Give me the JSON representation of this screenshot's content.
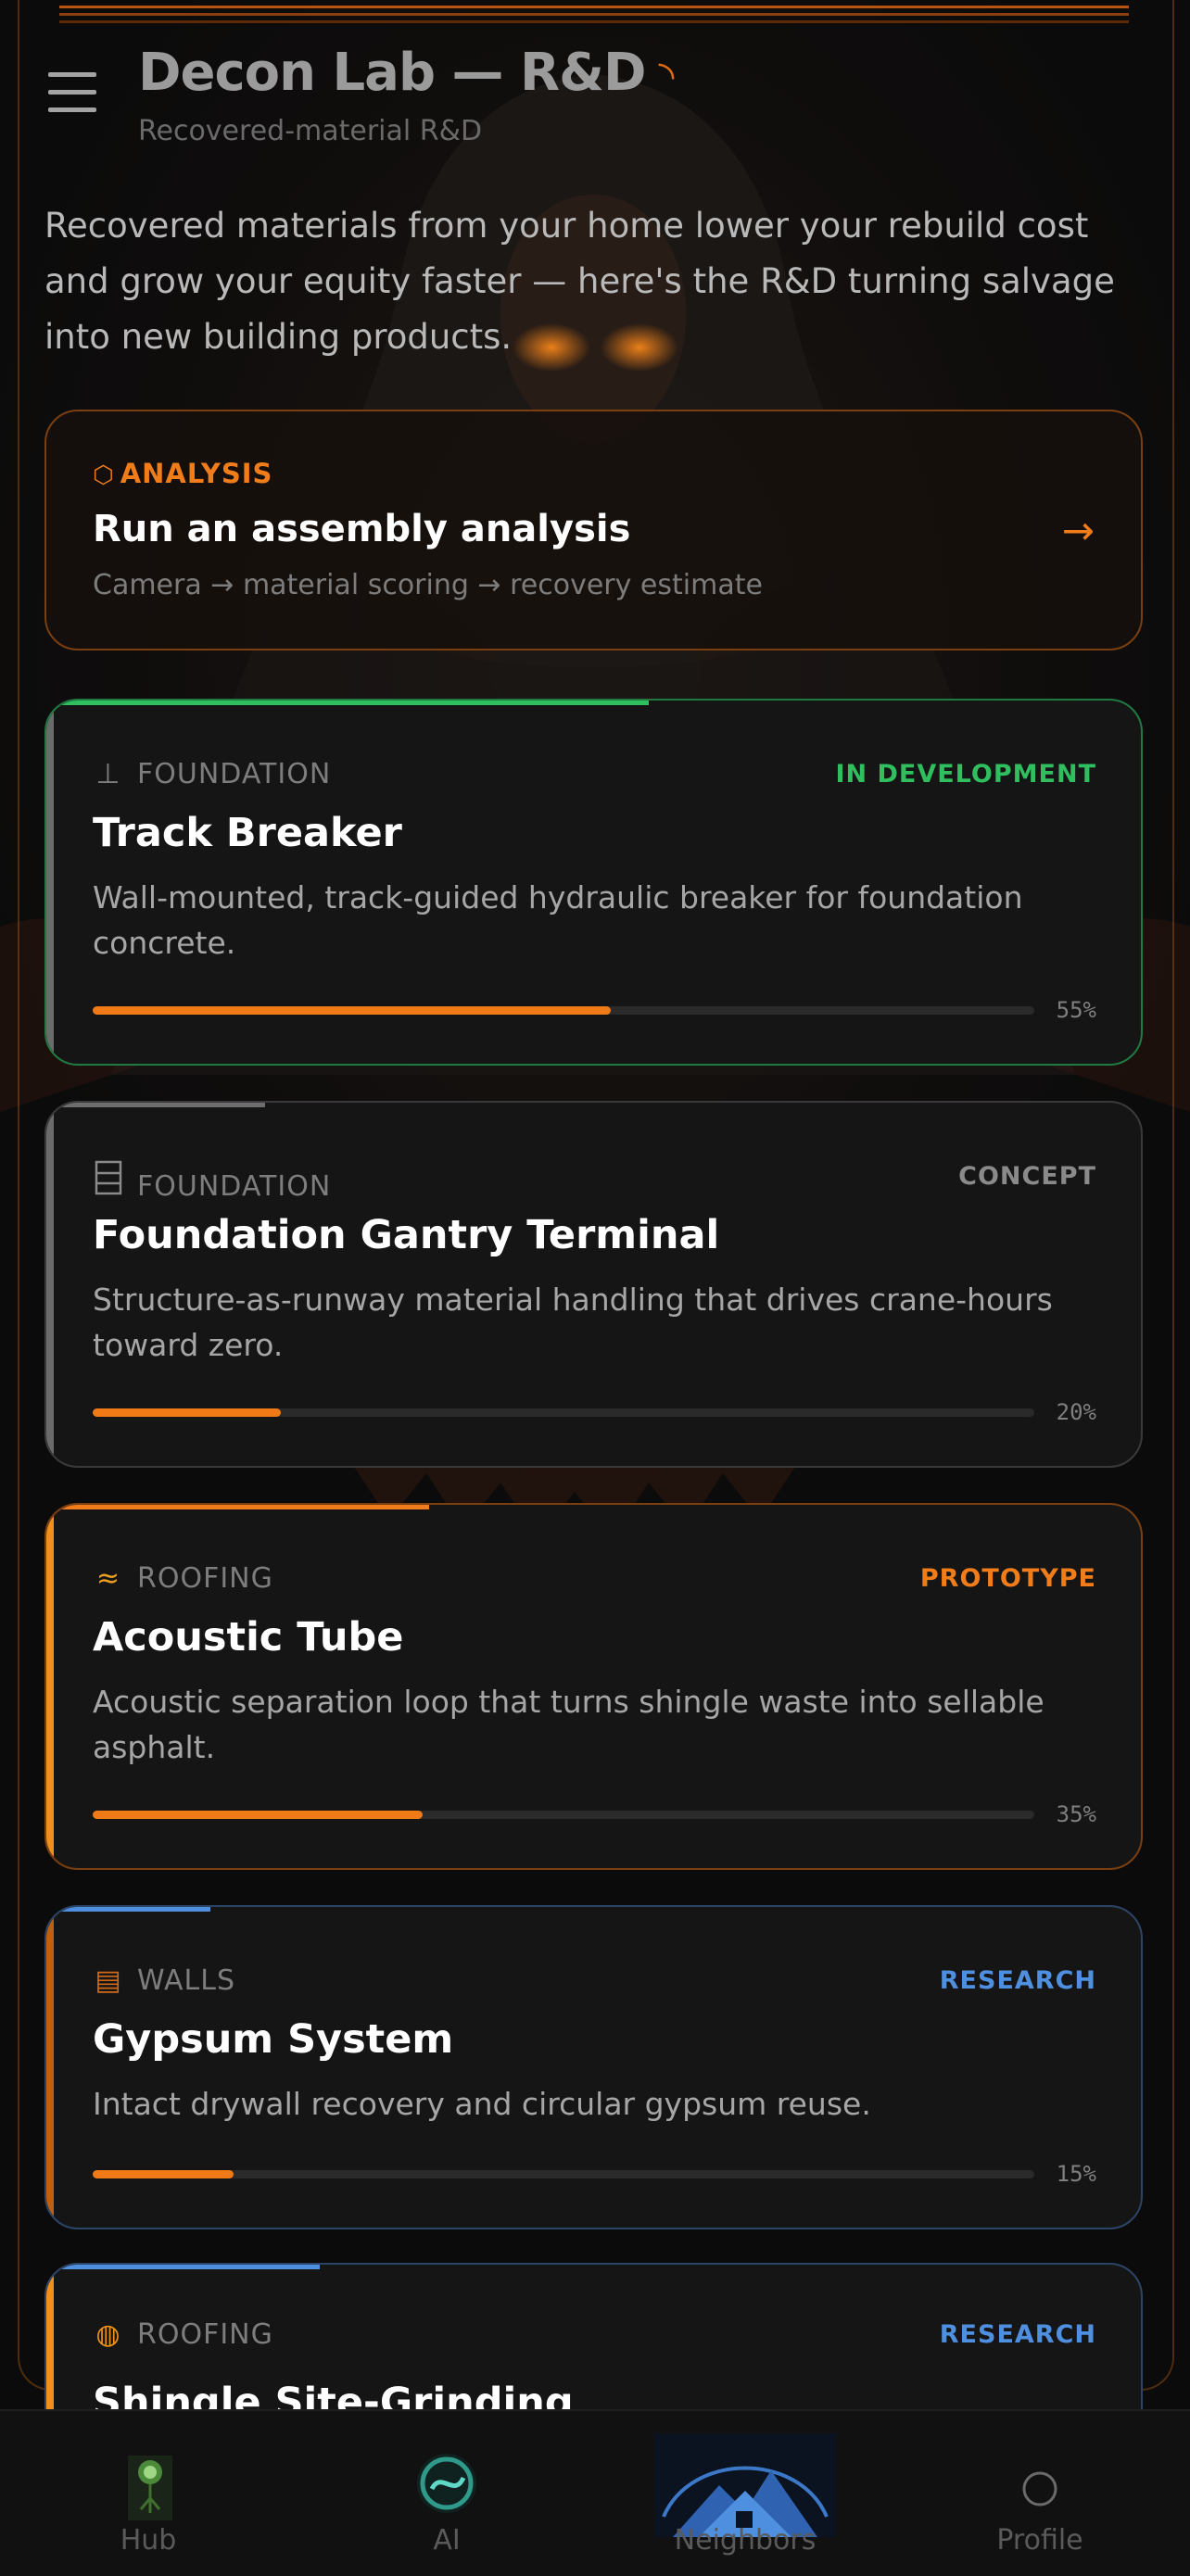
{
  "header": {
    "title": "Decon Lab — R&D",
    "title_glyph": "◝",
    "subtitle": "Recovered-material R&D"
  },
  "intro": "Recovered materials from your home lower your rebuild cost and grow your equity faster — here's the R&D turning salvage into new building products.",
  "analysis": {
    "eyebrow_icon": "⬡",
    "eyebrow": "ANALYSIS",
    "heading": "Run an assembly analysis",
    "sub": "Camera → material scoring → recovery estimate",
    "arrow": "→"
  },
  "projects": [
    {
      "icon": "foundation-icon",
      "icon_glyph": "⊥",
      "category": "FOUNDATION",
      "status": "IN DEVELOPMENT",
      "status_color": "#2fbf5f",
      "name": "Track Breaker",
      "description": "Wall-mounted, track-guided hydraulic breaker for foundation concrete.",
      "progress": 55,
      "progress_label": "55%"
    },
    {
      "icon": "building-icon",
      "icon_glyph": "",
      "category": "FOUNDATION",
      "status": "CONCEPT",
      "status_color": "#8a8a8a",
      "name": "Foundation Gantry Terminal",
      "description": "Structure-as-runway material handling that drives crane-hours toward zero.",
      "progress": 20,
      "progress_label": "20%"
    },
    {
      "icon": "waves-icon",
      "icon_glyph": "≈",
      "category": "ROOFING",
      "status": "PROTOTYPE",
      "status_color": "#f07d1a",
      "name": "Acoustic Tube",
      "description": "Acoustic separation loop that turns shingle waste into sellable asphalt.",
      "progress": 35,
      "progress_label": "35%"
    },
    {
      "icon": "drywall-icon",
      "icon_glyph": "▤",
      "category": "WALLS",
      "status": "RESEARCH",
      "status_color": "#4f8fe0",
      "name": "Gypsum System",
      "description": "Intact drywall recovery and circular gypsum reuse.",
      "progress": 15,
      "progress_label": "15%"
    },
    {
      "icon": "grinder-icon",
      "icon_glyph": "◍",
      "category": "ROOFING",
      "status": "RESEARCH",
      "status_color": "#4f8fe0",
      "name": "Shingle Site-Grinding",
      "description": "",
      "progress": null,
      "progress_label": ""
    }
  ],
  "tabs": [
    {
      "label": "Hub",
      "icon": "tree-orb-icon"
    },
    {
      "label": "AI",
      "icon": "ai-orb-icon"
    },
    {
      "label": "Neighbors",
      "icon": "houses-icon"
    },
    {
      "label": "Profile",
      "icon": "profile-circle-icon"
    }
  ],
  "colors": {
    "accent": "#f07d1a",
    "background": "#0c0b0b",
    "card": "#151516",
    "green": "#2fbf5f",
    "blue": "#4f8fe0",
    "muted": "#8a8a8a"
  }
}
